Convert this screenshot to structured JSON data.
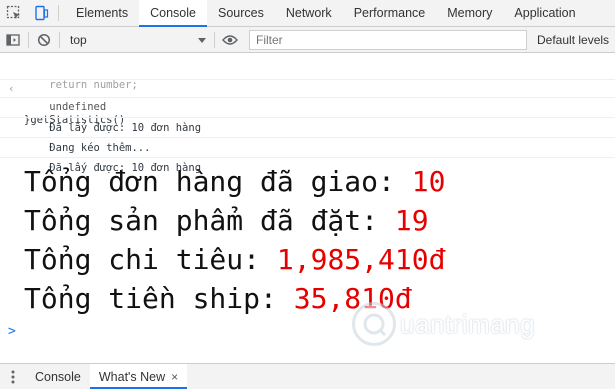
{
  "tabbar": {
    "tabs": [
      {
        "label": "Elements"
      },
      {
        "label": "Console"
      },
      {
        "label": "Sources"
      },
      {
        "label": "Network"
      },
      {
        "label": "Performance"
      },
      {
        "label": "Memory"
      },
      {
        "label": "Application"
      }
    ],
    "active_tab": "Console"
  },
  "toolbar": {
    "context": "top",
    "filter_placeholder": "Filter",
    "levels_label": "Default levels"
  },
  "console": {
    "code_line_1": "    return number;",
    "code_line_2": "}getStatistics()",
    "return_value": "undefined",
    "log_1": "Đã lấy được: 10 đơn hàng",
    "log_2": "Đang kéo thêm...",
    "log_3": "Đã lấy được: 10 đơn hàng",
    "prompt_symbol": ">"
  },
  "stats": [
    {
      "label": "Tổng đơn hàng đã giao: ",
      "value": "10"
    },
    {
      "label": "Tổng sản phẩm đã đặt: ",
      "value": "19"
    },
    {
      "label": "Tổng chi tiêu: ",
      "value": "1,985,410đ"
    },
    {
      "label": "Tổng tiền ship: ",
      "value": "35,810đ"
    }
  ],
  "watermark": {
    "text": "uantrimang"
  },
  "drawer": {
    "tab_console": "Console",
    "tab_whats_new": "What's New",
    "close_glyph": "×"
  },
  "colors": {
    "accent": "#1a73e8",
    "stat_value": "#e60000"
  },
  "icons": [
    "inspect-element-icon",
    "device-toolbar-icon",
    "sidebar-toggle-icon",
    "clear-console-icon",
    "dropdown-arrow-icon",
    "eye-icon",
    "drawer-menu-icon"
  ]
}
